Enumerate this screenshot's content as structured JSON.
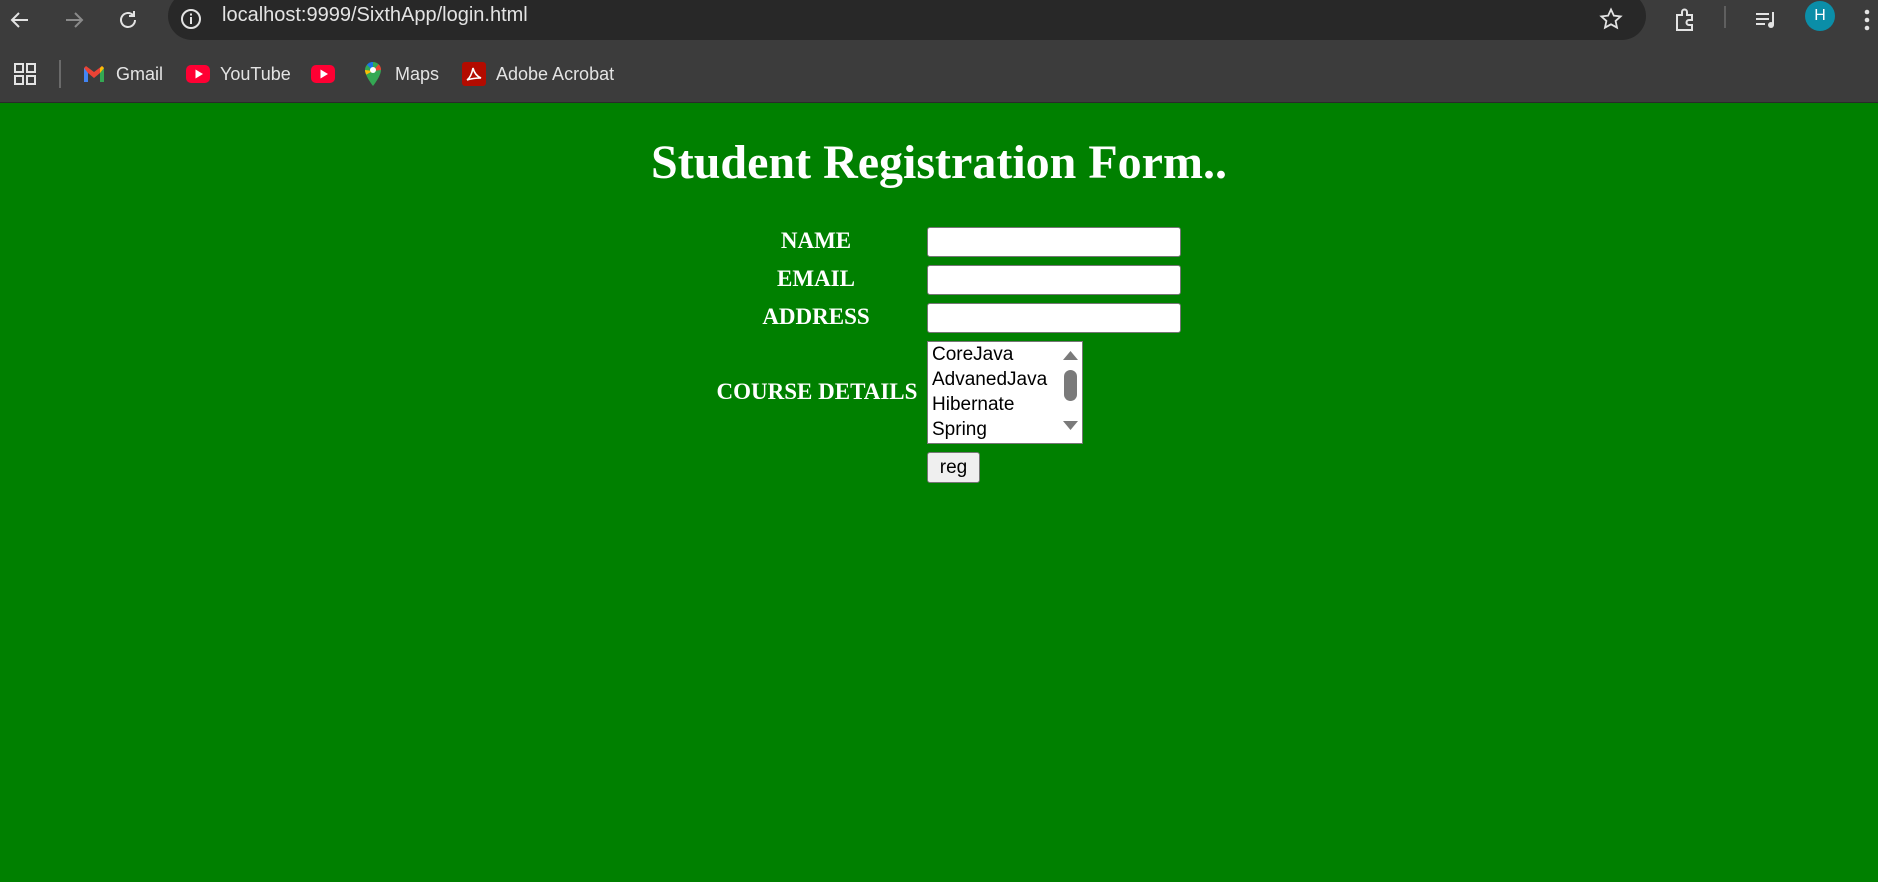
{
  "browser": {
    "url": "localhost:9999/SixthApp/login.html",
    "avatar_initial": "H",
    "bookmarks": [
      {
        "label": "Gmail",
        "icon": "gmail-icon"
      },
      {
        "label": "YouTube",
        "icon": "youtube-icon"
      },
      {
        "label": "",
        "icon": "youtube-icon"
      },
      {
        "label": "Maps",
        "icon": "maps-icon"
      },
      {
        "label": "Adobe Acrobat",
        "icon": "acrobat-icon"
      }
    ]
  },
  "page": {
    "title": "Student Registration Form..",
    "background_color": "#008000",
    "fields": {
      "name_label": "NAME",
      "name_value": "",
      "email_label": "EMAIL",
      "email_value": "",
      "address_label": "ADDRESS",
      "address_value": ""
    },
    "course": {
      "label": "COURSE DETAILS",
      "options": [
        "CoreJava",
        "AdvanedJava",
        "Hibernate",
        "Spring"
      ]
    },
    "submit_label": "reg"
  }
}
